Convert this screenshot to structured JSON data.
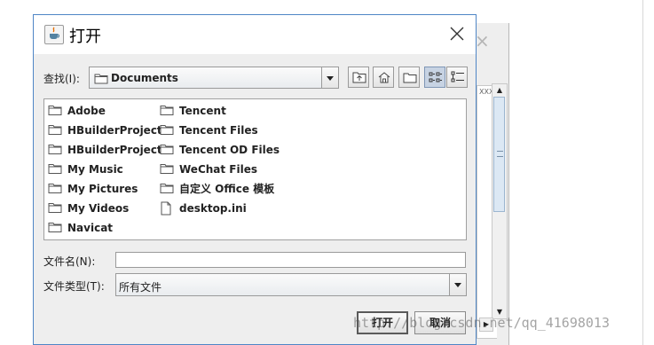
{
  "dialog": {
    "title": "打开",
    "look_in_label": "查找(I):",
    "look_in_value": "Documents",
    "file_name_label": "文件名(N):",
    "file_name_value": "",
    "file_type_label": "文件类型(T):",
    "file_type_value": "所有文件",
    "open_button": "打开",
    "cancel_button": "取消"
  },
  "files_col1": [
    {
      "name": "Adobe",
      "type": "folder"
    },
    {
      "name": "HBuilderProject",
      "type": "folder"
    },
    {
      "name": "HBuilderProjects",
      "type": "folder"
    },
    {
      "name": "My Music",
      "type": "folder"
    },
    {
      "name": "My Pictures",
      "type": "folder"
    },
    {
      "name": "My Videos",
      "type": "folder"
    },
    {
      "name": "Navicat",
      "type": "folder"
    }
  ],
  "files_col2": [
    {
      "name": "Tencent",
      "type": "folder"
    },
    {
      "name": "Tencent Files",
      "type": "folder"
    },
    {
      "name": "Tencent OD Files",
      "type": "folder"
    },
    {
      "name": "WeChat Files",
      "type": "folder"
    },
    {
      "name": "自定义 Office 模板",
      "type": "folder"
    },
    {
      "name": "desktop.ini",
      "type": "file"
    }
  ],
  "background": {
    "snippet": "XXXX",
    "watermark": "http://blog.csdn.net/qq_41698013"
  },
  "colors": {
    "dialog_border": "#4f86c6",
    "dialog_bg": "#eeeeee",
    "active_view": "#c7d3e3"
  }
}
